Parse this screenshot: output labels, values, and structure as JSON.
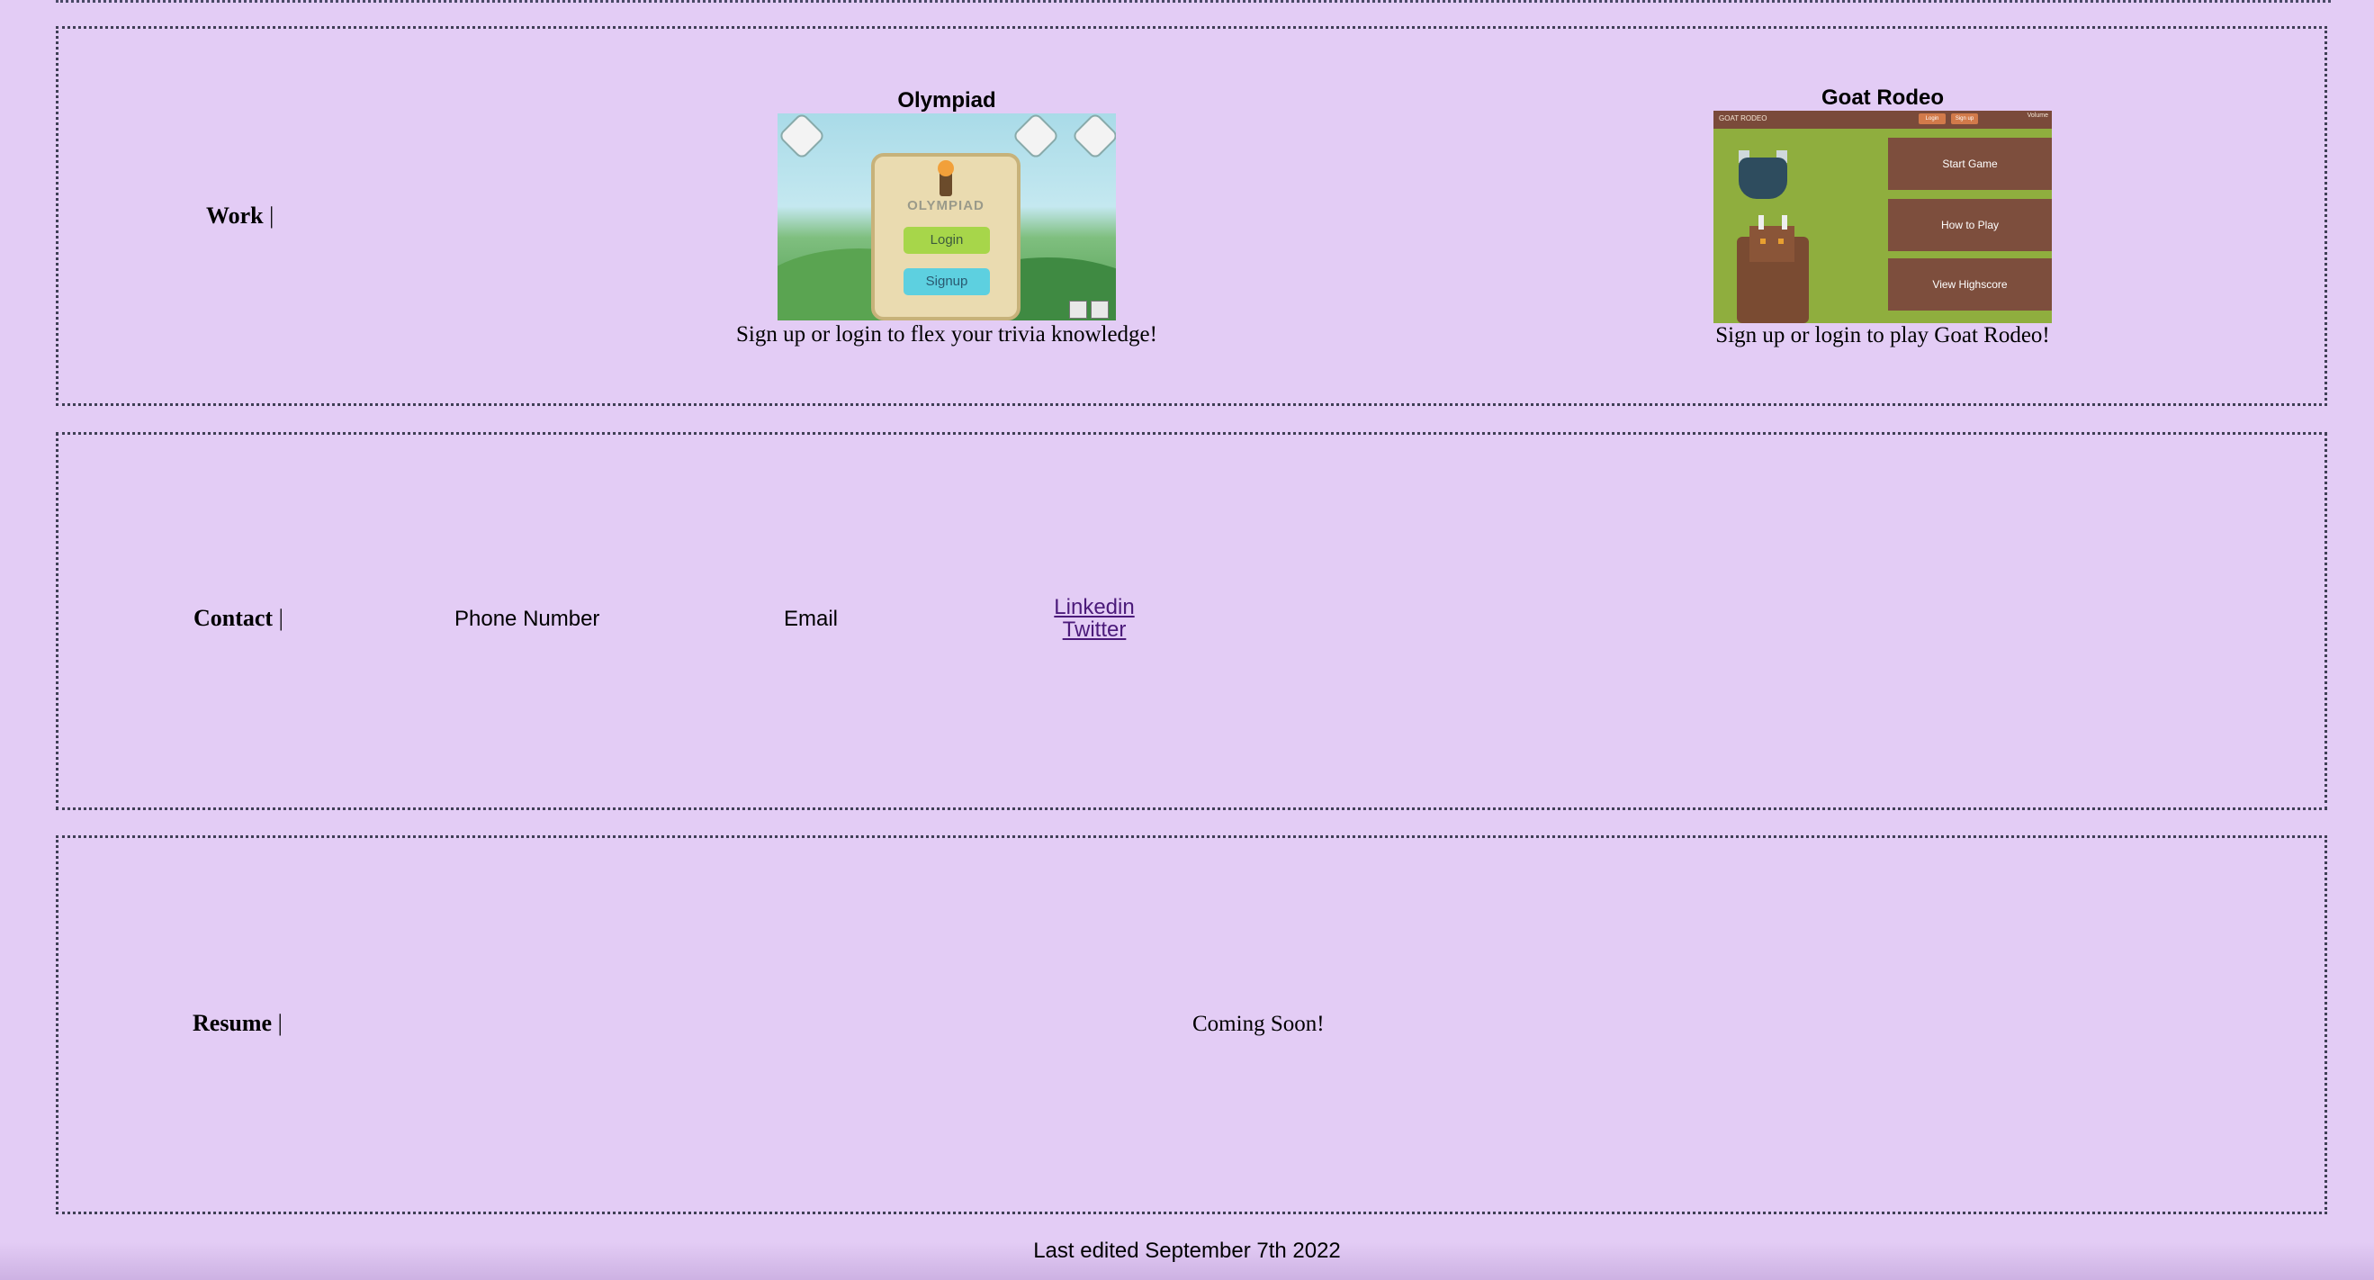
{
  "work": {
    "label": "Work",
    "separator": "|",
    "projects": [
      {
        "title": "Olympiad",
        "description": "Sign up or login to flex your trivia knowledge!",
        "screenshot": {
          "logo": "OLYMPIAD",
          "login_label": "Login",
          "signup_label": "Signup"
        }
      },
      {
        "title": "Goat Rodeo",
        "description": "Sign up or login to play Goat Rodeo!",
        "screenshot": {
          "app_name": "GOAT RODEO",
          "login_label": "Login",
          "signup_label": "Sign up",
          "volume_label": "Volume",
          "menu": [
            "Start Game",
            "How to Play",
            "View Highscore"
          ]
        }
      }
    ]
  },
  "contact": {
    "label": "Contact",
    "separator": "|",
    "phone_label": "Phone Number",
    "email_label": "Email",
    "links": {
      "linkedin": "Linkedin",
      "twitter": "Twitter"
    }
  },
  "resume": {
    "label": "Resume",
    "separator": "|",
    "status": "Coming Soon!"
  },
  "footer": {
    "text": "Last edited September 7th 2022"
  },
  "colors": {
    "background": "#e3ccf5",
    "link": "#4b1a7a",
    "border": "#3f3f55"
  }
}
